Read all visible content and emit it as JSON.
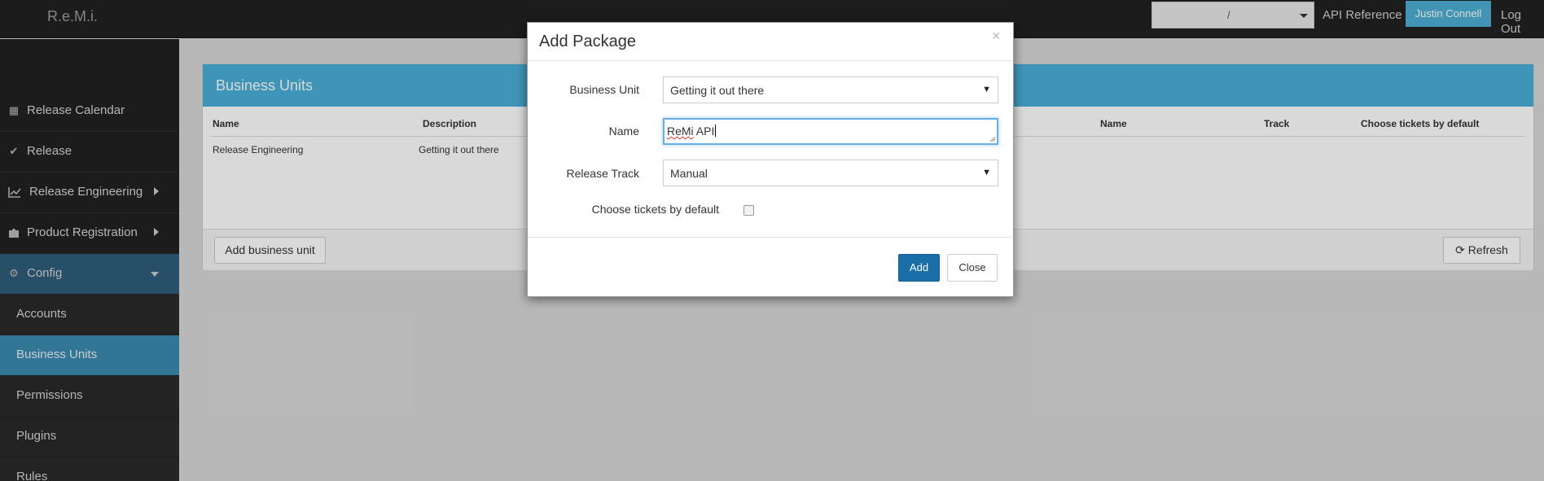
{
  "app": {
    "brand": "R.e.M.i."
  },
  "topbar": {
    "context_select_value": "/",
    "api_reference": "API Reference",
    "user": "Justin Connell",
    "logout": "Log Out"
  },
  "sidebar": {
    "items": [
      {
        "label": "Release Calendar",
        "icon": "calendar-icon"
      },
      {
        "label": "Release",
        "icon": "check-icon"
      },
      {
        "label": "Release Engineering",
        "icon": "line-chart-icon"
      },
      {
        "label": "Product Registration",
        "icon": "puzzle-icon"
      },
      {
        "label": "Config",
        "icon": "gear-icon"
      }
    ],
    "sub_items": [
      "Accounts",
      "Business Units",
      "Permissions",
      "Plugins",
      "Rules"
    ],
    "active_sub_item": "Business Units"
  },
  "panel": {
    "title": "Business Units",
    "left_columns": [
      "Name",
      "Description"
    ],
    "right_columns": [
      "Name",
      "Track",
      "Choose tickets by default"
    ],
    "rows": [
      {
        "name": "Release Engineering",
        "description": "Getting it out there"
      }
    ],
    "add_button": "Add business unit",
    "refresh_button": "Refresh"
  },
  "modal": {
    "title": "Add Package",
    "close_glyph": "×",
    "business_unit_label": "Business Unit",
    "business_unit_value": "Getting it out there",
    "name_label": "Name",
    "name_value_underlined": "ReMi",
    "name_value_rest": " API",
    "release_track_label": "Release Track",
    "release_track_value": "Manual",
    "choose_tickets_label": "Choose tickets by default",
    "choose_tickets_checked": false,
    "add_button": "Add",
    "close_button": "Close"
  },
  "colors": {
    "accent": "#4aafd9",
    "primary_button": "#1b6fa8",
    "sidebar_bg": "#222222",
    "active_item": "#3d8ab0"
  }
}
